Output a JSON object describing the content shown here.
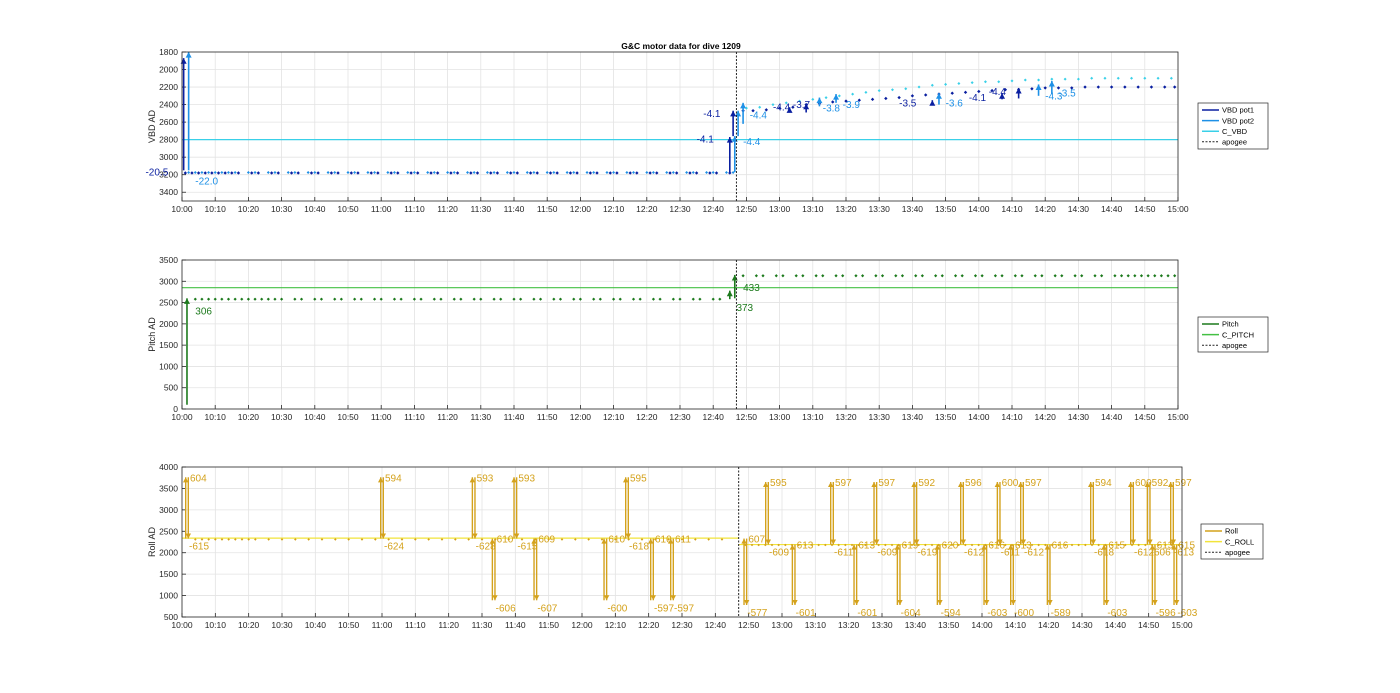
{
  "chart_data": [
    {
      "type": "line",
      "title": "G&C motor data for dive 1209",
      "ylabel": "VBD AD",
      "y_reversed": true,
      "ylim": [
        1800,
        3500
      ],
      "yticks": [
        "1800",
        "2000",
        "2200",
        "2400",
        "2600",
        "2800",
        "3000",
        "3200",
        "3400"
      ],
      "xlim_minutes": [
        0,
        300
      ],
      "xticks": [
        "10:00",
        "10:10",
        "10:20",
        "10:30",
        "10:40",
        "10:50",
        "11:00",
        "11:10",
        "11:20",
        "11:30",
        "11:40",
        "11:50",
        "12:00",
        "12:10",
        "12:20",
        "12:30",
        "12:40",
        "12:50",
        "13:00",
        "13:10",
        "13:20",
        "13:30",
        "13:40",
        "13:50",
        "14:00",
        "14:10",
        "14:20",
        "14:30",
        "14:40",
        "14:50",
        "15:00"
      ],
      "grid": true,
      "legend_position": "right",
      "legend": [
        "VBD pot1",
        "VBD pot2",
        "C_VBD",
        "apogee"
      ],
      "colors": {
        "pot1": "#0a1fa0",
        "pot2": "#1e90e6",
        "c_line": "#39d0e8",
        "apogee": "#222222"
      },
      "c_value": 2800,
      "apogee_minute": 167,
      "pot1_base": {
        "from_minute": 1,
        "to_minute": 166,
        "step": 2,
        "value": 3180
      },
      "pot2_base": {
        "from_minute": 2,
        "to_minute": 166,
        "step": 2,
        "value": 3175
      },
      "pot1_after": {
        "x": [
          169,
          172,
          176,
          180,
          184,
          188,
          192,
          196,
          200,
          204,
          208,
          212,
          216,
          220,
          224,
          228,
          232,
          236,
          240,
          244,
          248,
          252,
          256,
          260,
          264,
          268,
          272,
          276,
          280,
          284,
          288,
          292,
          296,
          299
        ],
        "y": [
          2470,
          2470,
          2460,
          2440,
          2430,
          2400,
          2390,
          2370,
          2360,
          2350,
          2340,
          2330,
          2320,
          2300,
          2290,
          2280,
          2270,
          2260,
          2250,
          2240,
          2230,
          2230,
          2220,
          2210,
          2210,
          2210,
          2200,
          2200,
          2200,
          2200,
          2200,
          2200,
          2200,
          2200
        ]
      },
      "pot2_after": {
        "x": [
          170,
          174,
          178,
          182,
          186,
          190,
          194,
          198,
          202,
          206,
          210,
          214,
          218,
          222,
          226,
          230,
          234,
          238,
          242,
          246,
          250,
          254,
          258,
          262,
          266,
          270,
          274,
          278,
          282,
          286,
          290,
          294,
          298
        ],
        "y": [
          2440,
          2430,
          2400,
          2380,
          2360,
          2340,
          2320,
          2300,
          2280,
          2260,
          2240,
          2230,
          2220,
          2200,
          2180,
          2170,
          2160,
          2150,
          2140,
          2140,
          2130,
          2120,
          2120,
          2110,
          2110,
          2110,
          2100,
          2100,
          2100,
          2100,
          2100,
          2100,
          2100
        ]
      },
      "events": [
        {
          "x": 0.5,
          "y0": 3150,
          "y1": 1870,
          "color": "#0a1fa0",
          "label": "-20.5",
          "lx": -11,
          "ly": 3170,
          "lc": "#0a1fa0"
        },
        {
          "x": 2,
          "y0": 3150,
          "y1": 1800,
          "color": "#1e90e6",
          "label": "-22.0",
          "lx": 4,
          "ly": 3270,
          "lc": "#1e90e6"
        },
        {
          "x": 165,
          "y0": 3170,
          "y1": 2770,
          "color": "#0a1fa0",
          "label": "-4.1",
          "lx": 155,
          "ly": 2790,
          "lc": "#0a1fa0"
        },
        {
          "x": 166.5,
          "y0": 3170,
          "y1": 2760,
          "color": "#1e90e6",
          "label": "",
          "lx": 0,
          "ly": 0,
          "lc": "#1e90e6"
        },
        {
          "x": 167.5,
          "y0": 2760,
          "y1": 2470,
          "color": "#1e90e6",
          "label": "-4.4",
          "lx": 169,
          "ly": 2820,
          "lc": "#1e90e6"
        },
        {
          "x": 166,
          "y0": 2760,
          "y1": 2470,
          "color": "#0a1fa0",
          "label": "-4.1",
          "lx": 157,
          "ly": 2500,
          "lc": "#0a1fa0"
        },
        {
          "x": 169,
          "y0": 2620,
          "y1": 2380,
          "color": "#1e90e6",
          "label": "-4.4",
          "lx": 171,
          "ly": 2520,
          "lc": "#1e90e6"
        },
        {
          "x": 183,
          "y0": 2490,
          "y1": 2430,
          "color": "#0a1fa0",
          "label": "-4.4",
          "lx": 178,
          "ly": 2430,
          "lc": "#0a1fa0"
        },
        {
          "x": 188,
          "y0": 2490,
          "y1": 2390,
          "color": "#0a1fa0",
          "label": "-3.7",
          "lx": 184,
          "ly": 2400,
          "lc": "#0a1fa0"
        },
        {
          "x": 192,
          "y0": 2420,
          "y1": 2320,
          "color": "#1e90e6",
          "label": "-3.8",
          "lx": 193,
          "ly": 2440,
          "lc": "#1e90e6"
        },
        {
          "x": 197,
          "y0": 2380,
          "y1": 2280,
          "color": "#1e90e6",
          "label": "-3.9",
          "lx": 199,
          "ly": 2400,
          "lc": "#1e90e6"
        },
        {
          "x": 226,
          "y0": 2400,
          "y1": 2350,
          "color": "#0a1fa0",
          "label": "-3.5",
          "lx": 216,
          "ly": 2380,
          "lc": "#0a1fa0"
        },
        {
          "x": 228,
          "y0": 2400,
          "y1": 2270,
          "color": "#1e90e6",
          "label": "-3.6",
          "lx": 230,
          "ly": 2380,
          "lc": "#1e90e6"
        },
        {
          "x": 247,
          "y0": 2340,
          "y1": 2270,
          "color": "#0a1fa0",
          "label": "-4.1",
          "lx": 237,
          "ly": 2320,
          "lc": "#0a1fa0"
        },
        {
          "x": 252,
          "y0": 2330,
          "y1": 2210,
          "color": "#0a1fa0",
          "label": "-4.4",
          "lx": 243,
          "ly": 2250,
          "lc": "#0a1fa0"
        },
        {
          "x": 258,
          "y0": 2300,
          "y1": 2170,
          "color": "#1e90e6",
          "label": "-4.3",
          "lx": 260,
          "ly": 2300,
          "lc": "#1e90e6"
        },
        {
          "x": 262,
          "y0": 2280,
          "y1": 2130,
          "color": "#1e90e6",
          "label": "-3.5",
          "lx": 264,
          "ly": 2270,
          "lc": "#1e90e6"
        }
      ]
    },
    {
      "type": "line",
      "ylabel": "Pitch AD",
      "ylim": [
        0,
        3500
      ],
      "yticks": [
        "0",
        "500",
        "1000",
        "1500",
        "2000",
        "2500",
        "3000",
        "3500"
      ],
      "xlim_minutes": [
        0,
        300
      ],
      "xticks": [
        "10:00",
        "10:10",
        "10:20",
        "10:30",
        "10:40",
        "10:50",
        "11:00",
        "11:10",
        "11:20",
        "11:30",
        "11:40",
        "11:50",
        "12:00",
        "12:10",
        "12:20",
        "12:30",
        "12:40",
        "12:50",
        "13:00",
        "13:10",
        "13:20",
        "13:30",
        "13:40",
        "13:50",
        "14:00",
        "14:10",
        "14:20",
        "14:30",
        "14:40",
        "14:50",
        "15:00"
      ],
      "grid": true,
      "legend_position": "right",
      "legend": [
        "Pitch",
        "C_PITCH",
        "apogee"
      ],
      "colors": {
        "series": "#1d7a1d",
        "c_line": "#44c044",
        "apogee": "#222222"
      },
      "c_value": 2850,
      "apogee_minute": 167,
      "segments": [
        {
          "from": 4,
          "to": 165,
          "step": 2,
          "value": 2580
        },
        {
          "from": 169,
          "to": 299,
          "step": 2,
          "value": 3130
        }
      ],
      "events": [
        {
          "x": 1.5,
          "y0": 100,
          "y1": 2600,
          "label": "306",
          "lx": 4,
          "ly": 2300
        },
        {
          "x": 166.5,
          "y0": 2600,
          "y1": 3150,
          "label": "433",
          "lx": 169,
          "ly": 2850
        },
        {
          "x": 165,
          "y0": 2580,
          "y1": 2780,
          "label": "373",
          "lx": 167,
          "ly": 2380
        }
      ]
    },
    {
      "type": "line",
      "ylabel": "Roll AD",
      "ylim": [
        500,
        4000
      ],
      "yticks": [
        "500",
        "1000",
        "1500",
        "2000",
        "2500",
        "3000",
        "3500",
        "4000"
      ],
      "xlim_minutes": [
        0,
        300
      ],
      "xticks": [
        "10:00",
        "10:10",
        "10:20",
        "10:30",
        "10:40",
        "10:50",
        "11:00",
        "11:10",
        "11:20",
        "11:30",
        "11:40",
        "11:50",
        "12:00",
        "12:10",
        "12:20",
        "12:30",
        "12:40",
        "12:50",
        "13:00",
        "13:10",
        "13:20",
        "13:30",
        "13:40",
        "13:50",
        "14:00",
        "14:10",
        "14:20",
        "14:30",
        "14:40",
        "14:50",
        "15:00"
      ],
      "grid": true,
      "legend_position": "right",
      "legend": [
        "Roll",
        "C_ROLL",
        "apogee"
      ],
      "colors": {
        "series": "#d4a21c",
        "c_line": "#f2e43a",
        "apogee": "#222222"
      },
      "c_before": 2340,
      "c_after": 2190,
      "apogee_minute": 167,
      "segments": [
        {
          "from": 4,
          "to": 165,
          "step": 2,
          "value": 2310
        },
        {
          "from": 169,
          "to": 299,
          "step": 2,
          "value": 2180
        }
      ],
      "events": [
        {
          "x": 1.5,
          "top": 3760,
          "bot": 2330,
          "label_top": "604",
          "label_bot": "-615"
        },
        {
          "x": 60,
          "top": 3760,
          "bot": 2330,
          "label_top": "594",
          "label_bot": "-624"
        },
        {
          "x": 87.5,
          "top": 3760,
          "bot": 2330,
          "label_top": "593",
          "label_bot": "-628"
        },
        {
          "x": 93.5,
          "top": 2330,
          "bot": 890,
          "label_top": "610",
          "label_bot": "-606"
        },
        {
          "x": 100,
          "top": 3760,
          "bot": 2330,
          "label_top": "593",
          "label_bot": "-615"
        },
        {
          "x": 106,
          "top": 2330,
          "bot": 890,
          "label_top": "609",
          "label_bot": "-607"
        },
        {
          "x": 127,
          "top": 2330,
          "bot": 890,
          "label_top": "610",
          "label_bot": "-600"
        },
        {
          "x": 133.5,
          "top": 3760,
          "bot": 2330,
          "label_top": "595",
          "label_bot": "-618"
        },
        {
          "x": 141,
          "top": 2330,
          "bot": 890,
          "label_top": "610",
          "label_bot": "-597"
        },
        {
          "x": 147,
          "top": 2330,
          "bot": 890,
          "label_top": "611",
          "label_bot": "-597"
        },
        {
          "x": 169,
          "top": 2330,
          "bot": 780,
          "label_top": "607",
          "label_bot": "-577"
        },
        {
          "x": 175.5,
          "top": 3650,
          "bot": 2190,
          "label_top": "595",
          "label_bot": "-609"
        },
        {
          "x": 183.5,
          "top": 2190,
          "bot": 780,
          "label_top": "613",
          "label_bot": "-601"
        },
        {
          "x": 195,
          "top": 3650,
          "bot": 2190,
          "label_top": "597",
          "label_bot": "-611"
        },
        {
          "x": 202,
          "top": 2190,
          "bot": 780,
          "label_top": "613",
          "label_bot": "-601"
        },
        {
          "x": 208,
          "top": 3650,
          "bot": 2190,
          "label_top": "597",
          "label_bot": "-609"
        },
        {
          "x": 215,
          "top": 2190,
          "bot": 780,
          "label_top": "619",
          "label_bot": "-604"
        },
        {
          "x": 220,
          "top": 3650,
          "bot": 2190,
          "label_top": "592",
          "label_bot": "-619"
        },
        {
          "x": 227,
          "top": 2190,
          "bot": 780,
          "label_top": "620",
          "label_bot": "-594"
        },
        {
          "x": 234,
          "top": 3650,
          "bot": 2190,
          "label_top": "596",
          "label_bot": "-612"
        },
        {
          "x": 241,
          "top": 2190,
          "bot": 780,
          "label_top": "616",
          "label_bot": "-603"
        },
        {
          "x": 245,
          "top": 3650,
          "bot": 2190,
          "label_top": "600",
          "label_bot": "-611"
        },
        {
          "x": 249,
          "top": 2190,
          "bot": 780,
          "label_top": "613",
          "label_bot": "-600"
        },
        {
          "x": 252,
          "top": 3650,
          "bot": 2190,
          "label_top": "597",
          "label_bot": "-612"
        },
        {
          "x": 260,
          "top": 2190,
          "bot": 780,
          "label_top": "616",
          "label_bot": "-589"
        },
        {
          "x": 273,
          "top": 3650,
          "bot": 2190,
          "label_top": "594",
          "label_bot": "-618"
        },
        {
          "x": 277,
          "top": 2190,
          "bot": 780,
          "label_top": "615",
          "label_bot": "-603"
        },
        {
          "x": 285,
          "top": 3650,
          "bot": 2190,
          "label_top": "600",
          "label_bot": "-612"
        },
        {
          "x": 290,
          "top": 3650,
          "bot": 2190,
          "label_top": "592",
          "label_bot": "-606"
        },
        {
          "x": 291.5,
          "top": 2190,
          "bot": 780,
          "label_top": "613",
          "label_bot": "-596"
        },
        {
          "x": 297,
          "top": 3650,
          "bot": 2190,
          "label_top": "597",
          "label_bot": "-613"
        },
        {
          "x": 298,
          "top": 2190,
          "bot": 780,
          "label_top": "615",
          "label_bot": "-603"
        }
      ]
    }
  ]
}
